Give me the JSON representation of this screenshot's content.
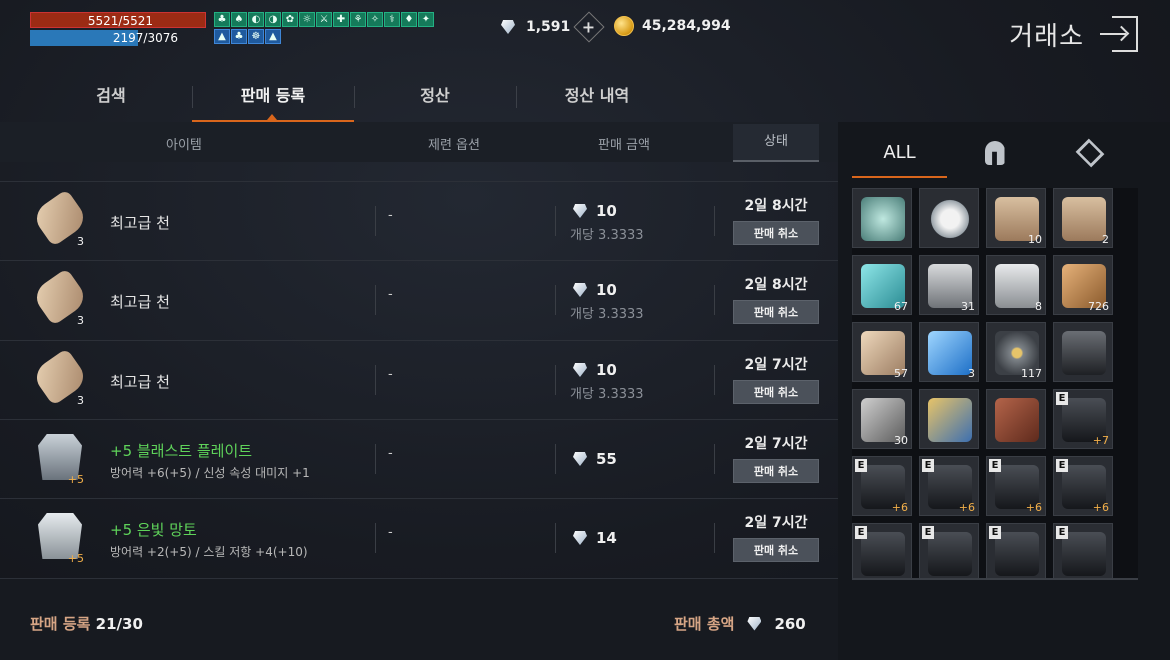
{
  "status": {
    "hp": "5521/5521",
    "mp": "2197/3076"
  },
  "currency": {
    "diamonds": "1,591",
    "gold": "45,284,994",
    "add_label": "+"
  },
  "header": {
    "title": "거래소"
  },
  "tabs": [
    {
      "label": "검색"
    },
    {
      "label": "판매 등록"
    },
    {
      "label": "정산"
    },
    {
      "label": "정산 내역"
    }
  ],
  "table": {
    "headers": {
      "item": "아이템",
      "option": "제련 옵션",
      "price": "판매 금액",
      "status": "상태"
    },
    "rows": [
      {
        "name": "최고급 천",
        "count": "3",
        "option": "-",
        "price": "10",
        "unit": "개당 3.3333",
        "time": "2일 8시간",
        "cancel": "판매 취소"
      },
      {
        "name": "최고급 천",
        "count": "3",
        "option": "-",
        "price": "10",
        "unit": "개당 3.3333",
        "time": "2일 8시간",
        "cancel": "판매 취소"
      },
      {
        "name": "최고급 천",
        "count": "3",
        "option": "-",
        "price": "10",
        "unit": "개당 3.3333",
        "time": "2일 7시간",
        "cancel": "판매 취소"
      },
      {
        "name": "+5 블래스트 플레이트",
        "count": "+5",
        "sub": "방어력 +6(+5) / 신성 속성 대미지 +1",
        "option": "-",
        "price": "55",
        "time": "2일 7시간",
        "cancel": "판매 취소"
      },
      {
        "name": "+5 은빛 망토",
        "count": "+5",
        "sub": "방어력 +2(+5) / 스킬 저항 +4(+10)",
        "option": "-",
        "price": "14",
        "time": "2일 7시간",
        "cancel": "판매 취소"
      }
    ]
  },
  "footer": {
    "registered_label": "판매 등록",
    "registered_value": "21/30",
    "total_label": "판매 총액",
    "total_value": "260"
  },
  "inventory": {
    "tabs": {
      "all": "ALL"
    },
    "slots": [
      {
        "icon": "necklace-icon",
        "count": ""
      },
      {
        "icon": "ring-icon",
        "count": ""
      },
      {
        "icon": "weapon-scroll-icon",
        "count": "10"
      },
      {
        "icon": "armor-scroll-icon",
        "count": "2"
      },
      {
        "icon": "teal-crystal-icon",
        "count": "67"
      },
      {
        "icon": "iron-ingot-icon",
        "count": "31"
      },
      {
        "icon": "silver-ingot-icon",
        "count": "8"
      },
      {
        "icon": "leather-roll-icon",
        "count": "726"
      },
      {
        "icon": "cloth-roll-icon",
        "count": "57"
      },
      {
        "icon": "blue-crystal-icon",
        "count": "3"
      },
      {
        "icon": "rune-stone-icon",
        "count": "117"
      },
      {
        "icon": "dark-armor-icon",
        "count": ""
      },
      {
        "icon": "gray-cloth-icon",
        "count": "30"
      },
      {
        "icon": "gold-shield-icon",
        "count": ""
      },
      {
        "icon": "hide-icon",
        "count": ""
      },
      {
        "icon": "dark-helmet-icon",
        "count": "+7",
        "equipped": "E"
      },
      {
        "icon": "dark-chest-icon",
        "count": "+6",
        "equipped": "E"
      },
      {
        "icon": "dark-pants-icon",
        "count": "+6",
        "equipped": "E"
      },
      {
        "icon": "dark-cloak-icon",
        "count": "+6",
        "equipped": "E"
      },
      {
        "icon": "dark-belt-icon",
        "count": "+6",
        "equipped": "E"
      },
      {
        "icon": "dark-shoulder-icon",
        "count": "",
        "equipped": "E"
      },
      {
        "icon": "dark-glove-icon",
        "count": "",
        "equipped": "E"
      },
      {
        "icon": "dark-boots-icon",
        "count": "",
        "equipped": "E"
      },
      {
        "icon": "dark-wing-icon",
        "count": "",
        "equipped": "E"
      }
    ]
  },
  "colors": {
    "accent": "#d9661c",
    "hp": "#9c2b14",
    "mp": "#2a78b8",
    "green_text": "#5fd35a",
    "buff": "#157a5a"
  }
}
